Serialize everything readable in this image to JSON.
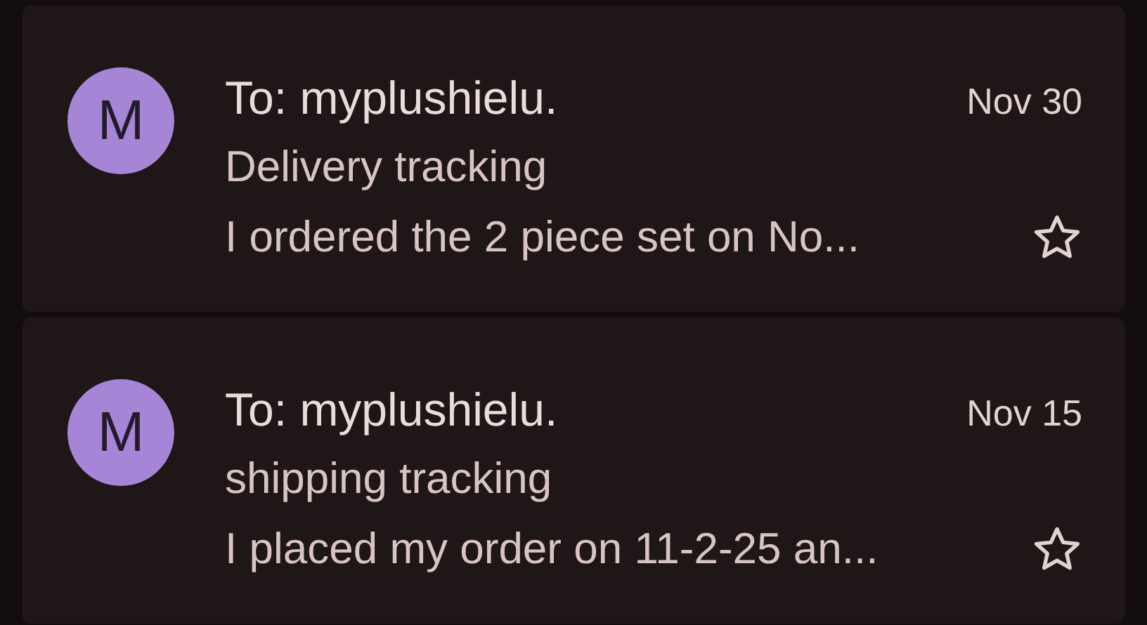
{
  "emails": [
    {
      "avatar": "M",
      "sender": "To: myplushielu.",
      "date": "Nov 30",
      "subject": "Delivery tracking",
      "snippet": "I ordered the 2 piece set on No...",
      "starred": false
    },
    {
      "avatar": "M",
      "sender": "To: myplushielu.",
      "date": "Nov 15",
      "subject": "shipping tracking",
      "snippet": "I placed my order on 11-2-25 an...",
      "starred": false
    }
  ]
}
